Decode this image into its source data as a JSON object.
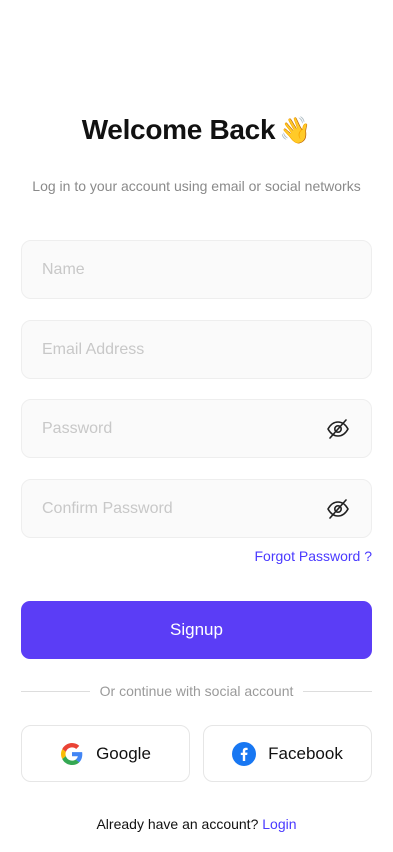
{
  "header": {
    "title": "Welcome Back",
    "emoji": "👋",
    "subtitle": "Log in to your account using email or social networks"
  },
  "form": {
    "name_placeholder": "Name",
    "email_placeholder": "Email Address",
    "password_placeholder": "Password",
    "confirm_placeholder": "Confirm Password",
    "forgot_label": "Forgot Password ?",
    "signup_label": "Signup"
  },
  "social": {
    "divider_text": "Or continue with social account",
    "google_label": "Google",
    "facebook_label": "Facebook"
  },
  "footer": {
    "prompt": "Already have an account?",
    "login_label": "Login"
  },
  "colors": {
    "accent": "#5b3df6",
    "link": "#4a3aff",
    "facebook": "#1877f2"
  }
}
